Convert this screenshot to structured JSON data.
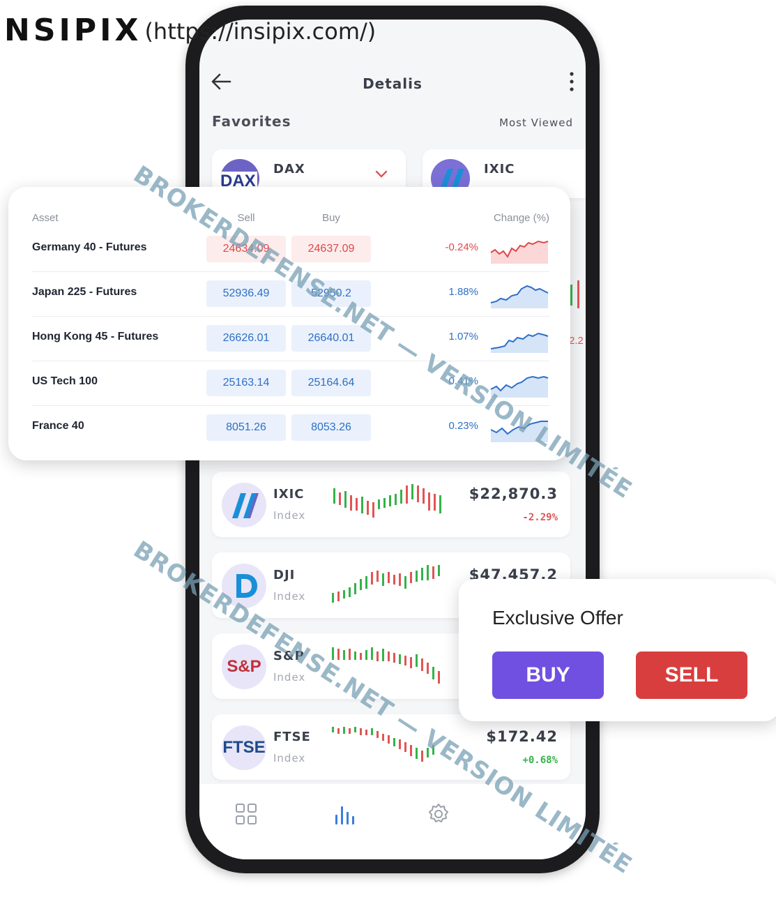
{
  "header": {
    "logo": "NSIPIX",
    "url": "(https://insipix.com/)"
  },
  "screen": {
    "title": "Detalis",
    "favorites_label": "Favorites",
    "most_viewed_label": "Most Viewed",
    "favorite_cards": [
      {
        "name": "DAX",
        "logo_text": "DAX"
      },
      {
        "name": "IXIC"
      }
    ],
    "peek_text": "2.2",
    "indexes": [
      {
        "name": "IXIC",
        "type": "Index",
        "price": "$22,870.3",
        "change": "-2.29%"
      },
      {
        "name": "DJI",
        "type": "Index",
        "price": "$47,457.2",
        "change": ""
      },
      {
        "name": "S&P",
        "type": "Index",
        "price": "",
        "change": ""
      },
      {
        "name": "FTSE",
        "type": "Index",
        "price": "$172.42",
        "change": "+0.68%"
      }
    ],
    "nav_icons": [
      "grid-icon",
      "bar-chart-icon",
      "gear-icon"
    ]
  },
  "market_table": {
    "headers": {
      "asset": "Asset",
      "sell": "Sell",
      "buy": "Buy",
      "change": "Change (%)"
    },
    "rows": [
      {
        "asset": "Germany 40 - Futures",
        "sell": "24634.09",
        "buy": "24637.09",
        "change": "-0.24%",
        "trend": "down"
      },
      {
        "asset": "Japan 225 - Futures",
        "sell": "52936.49",
        "buy": "52950.2",
        "change": "1.88%",
        "trend": "up"
      },
      {
        "asset": "Hong Kong 45 - Futures",
        "sell": "26626.01",
        "buy": "26640.01",
        "change": "1.07%",
        "trend": "up"
      },
      {
        "asset": "US Tech 100",
        "sell": "25163.14",
        "buy": "25164.64",
        "change": "0.41%",
        "trend": "up"
      },
      {
        "asset": "France 40",
        "sell": "8051.26",
        "buy": "8053.26",
        "change": "0.23%",
        "trend": "up"
      }
    ]
  },
  "offer": {
    "title": "Exclusive Offer",
    "buy_label": "BUY",
    "sell_label": "SELL"
  },
  "watermark": "BROKERDEFENSE.NET — VERSION LIMITÉE",
  "colors": {
    "up": "#2e6fc7",
    "down": "#e04848",
    "buy_button": "#7050e0",
    "sell_button": "#d93e3e",
    "candle_up": "#35b24a",
    "candle_down": "#e05555"
  }
}
